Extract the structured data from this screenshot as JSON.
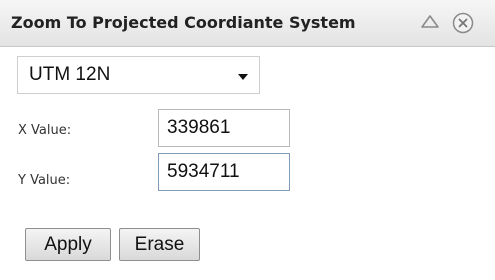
{
  "window": {
    "title": "Zoom To Projected Coordiante System"
  },
  "projection_select": {
    "selected": "UTM 12N"
  },
  "x_field": {
    "label": "X Value:",
    "value": "339861"
  },
  "y_field": {
    "label": "Y Value:",
    "value": "5934711"
  },
  "buttons": {
    "apply": "Apply",
    "erase": "Erase"
  },
  "icons": {
    "collapse": "collapse-triangle-icon",
    "close": "close-circle-x-icon"
  }
}
